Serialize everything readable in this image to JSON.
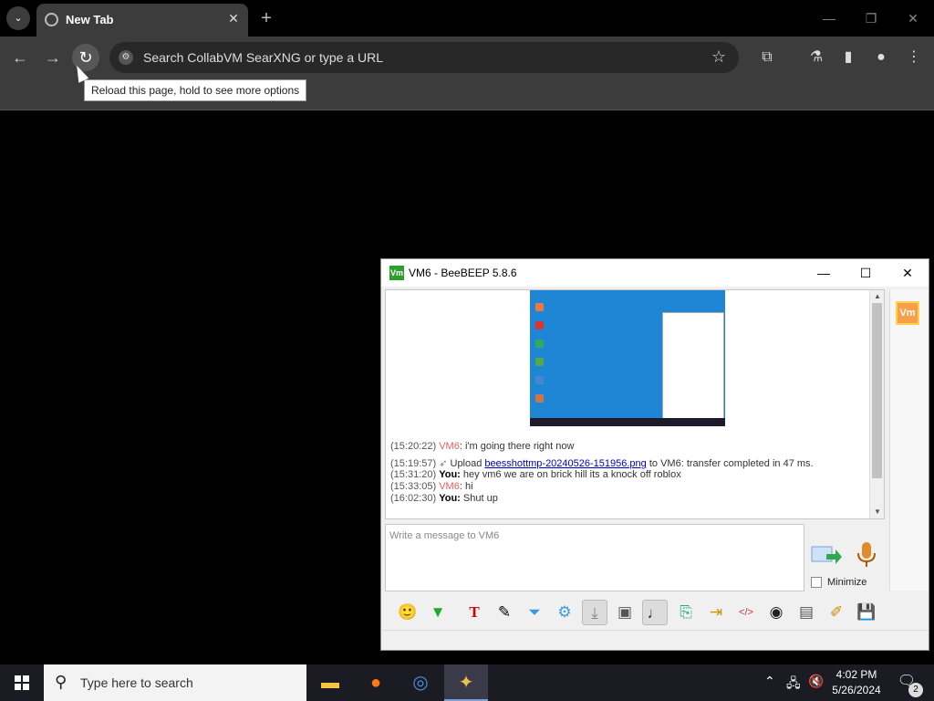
{
  "browser": {
    "tab_title": "New Tab",
    "omnibox_placeholder": "Search CollabVM SearXNG or type a URL",
    "tooltip": "Reload this page, hold to see more options"
  },
  "beebeep": {
    "window_title": "VM6 - BeeBEEP 5.8.6",
    "logo_text": "Vm",
    "chat": [
      {
        "time": "(15:20:22)",
        "sender": "VM6",
        "text": ": i'm going there right now"
      },
      {
        "time": "(15:19:57)",
        "pre": "Upload ",
        "link": "beesshottmp-20240526-151956.png",
        "post": " to VM6: transfer completed in 47 ms."
      },
      {
        "time": "(15:31:20)",
        "sender": "You:",
        "text": " hey vm6 we are on brick hill its a knock off roblox"
      },
      {
        "time": "(15:33:05)",
        "sender": "VM6",
        "text": ": hi"
      },
      {
        "time": "(16:02:30)",
        "sender": "You:",
        "text": " Shut up"
      }
    ],
    "input_placeholder": "Write a message to VM6",
    "minimize_label": "Minimize"
  },
  "taskbar": {
    "search_placeholder": "Type here to search",
    "time": "4:02 PM",
    "date": "5/26/2024",
    "notification_count": "2"
  },
  "colors": {
    "vm6_name": "#e0615e",
    "link": "#0000cc",
    "chrome_bg": "#3c3c3c",
    "taskbar_bg": "#1b1b23",
    "desktop_blue": "#1f86d6"
  }
}
